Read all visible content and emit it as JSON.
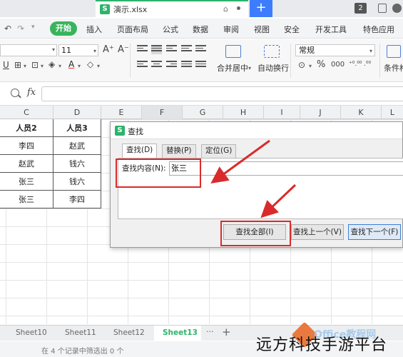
{
  "window": {
    "file_tab": "演示.xlsx",
    "file_icon_letter": "S",
    "tab_count": "2"
  },
  "menu": {
    "items": [
      "开始",
      "插入",
      "页面布局",
      "公式",
      "数据",
      "审阅",
      "视图",
      "安全",
      "开发工具",
      "特色应用"
    ]
  },
  "ribbon": {
    "font_name": "",
    "font_size": "11",
    "merge_label": "合并居中",
    "wrap_label": "自动换行",
    "number_format": "常规",
    "cond_format_label": "条件格"
  },
  "formula_bar": {
    "fx_label": "fx",
    "value": ""
  },
  "columns": [
    "C",
    "D",
    "E",
    "F",
    "G",
    "H",
    "I",
    "J",
    "K",
    "L"
  ],
  "table": {
    "headers": [
      "人员2",
      "人员3"
    ],
    "rows": [
      [
        "李四",
        "赵武"
      ],
      [
        "赵武",
        "钱六"
      ],
      [
        "张三",
        "钱六"
      ],
      [
        "张三",
        "李四"
      ]
    ]
  },
  "dialog": {
    "title": "查找",
    "icon_letter": "S",
    "tabs": [
      "查找(D)",
      "替换(P)",
      "定位(G)"
    ],
    "find_label": "查找内容(N):",
    "find_value": "张三",
    "buttons": {
      "find_all": "查找全部(I)",
      "find_prev": "查找上一个(V)",
      "find_next": "查找下一个(F)"
    }
  },
  "sheets": {
    "tabs": [
      "Sheet10",
      "Sheet11",
      "Sheet12",
      "Sheet13"
    ],
    "active": "Sheet13"
  },
  "status": {
    "text": "在 4 个记录中筛选出 0 个"
  },
  "watermark": {
    "text": "远方科技手游平台",
    "logo_text": "Office教程网"
  },
  "colors": {
    "accent_green": "#39b45d",
    "annotation_red": "#d92b2b",
    "new_tab_blue": "#3d7dfd"
  }
}
